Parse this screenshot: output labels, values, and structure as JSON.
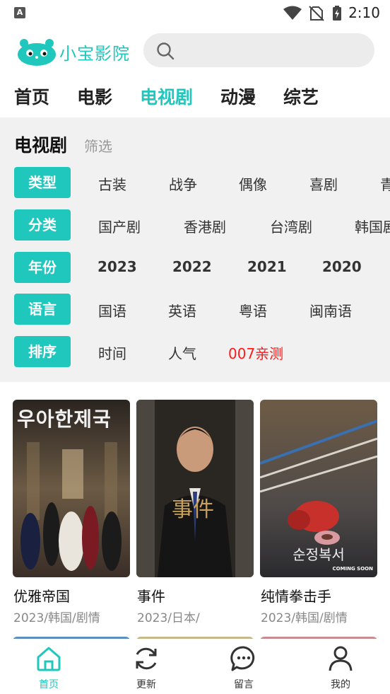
{
  "status_bar": {
    "time": "2:10",
    "app_badge": "A"
  },
  "header": {
    "app_name": "小宝影院",
    "search_placeholder": ""
  },
  "nav_tabs": [
    {
      "label": "首页",
      "active": false
    },
    {
      "label": "电影",
      "active": false
    },
    {
      "label": "电视剧",
      "active": true
    },
    {
      "label": "动漫",
      "active": false
    },
    {
      "label": "综艺",
      "active": false
    }
  ],
  "filter": {
    "title": "电视剧",
    "subtitle": "筛选",
    "rows": [
      {
        "chip": "类型",
        "options": [
          "古装",
          "战争",
          "偶像",
          "喜剧",
          "青"
        ]
      },
      {
        "chip": "分类",
        "options": [
          "国产剧",
          "香港剧",
          "台湾剧",
          "韩国剧"
        ]
      },
      {
        "chip": "年份",
        "options": [
          "2023",
          "2022",
          "2021",
          "2020"
        ]
      },
      {
        "chip": "语言",
        "options": [
          "国语",
          "英语",
          "粤语",
          "闽南语"
        ]
      },
      {
        "chip": "排序",
        "options": [
          "时间",
          "人气",
          "007亲测"
        ]
      }
    ]
  },
  "cards": [
    {
      "title": "优雅帝国",
      "meta": "2023/韩国/剧情",
      "poster_text": "우아한제국"
    },
    {
      "title": "事件",
      "meta": "2023/日本/",
      "poster_text": "事件"
    },
    {
      "title": "纯情拳击手",
      "meta": "2023/韩国/剧情",
      "poster_text": "순정복서",
      "poster_subtext": "COMING SOON"
    }
  ],
  "bottom_nav": [
    {
      "label": "首页",
      "icon": "home-icon",
      "active": true
    },
    {
      "label": "更新",
      "icon": "refresh-icon",
      "active": false
    },
    {
      "label": "留言",
      "icon": "message-icon",
      "active": false
    },
    {
      "label": "我的",
      "icon": "user-icon",
      "active": false
    }
  ],
  "colors": {
    "accent": "#1fc7bd",
    "highlight_red": "#ff1a1a",
    "panel_bg": "#f1f1f1"
  }
}
